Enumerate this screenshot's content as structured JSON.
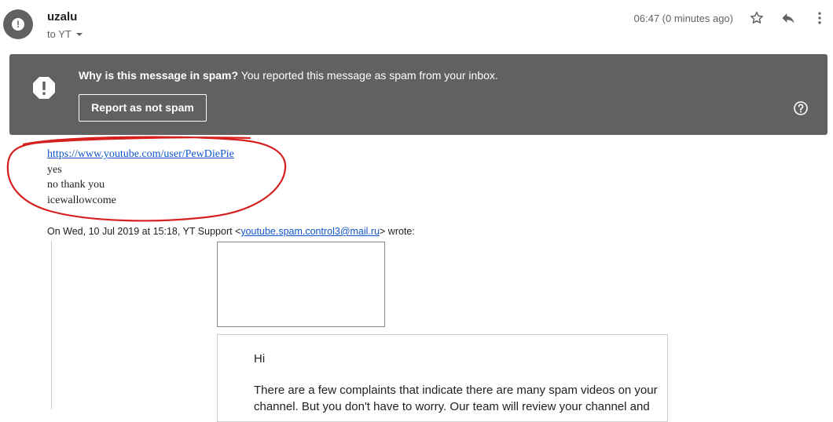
{
  "header": {
    "sender": "uzalu",
    "recipient": "to YT",
    "timestamp": "06:47 (0 minutes ago)",
    "icons": {
      "avatar": "warning-icon",
      "star": "star-icon",
      "reply": "reply-icon",
      "more": "more-vert-icon"
    }
  },
  "banner": {
    "title": "Why is this message in spam?",
    "description": " You reported this message as spam from your inbox.",
    "button_label": "Report as not spam",
    "icons": {
      "warning": "warning-icon",
      "help": "help-icon"
    },
    "bg_color": "#616161"
  },
  "message": {
    "link": "https://www.youtube.com/user/PewDiePie",
    "lines": [
      "yes",
      "no thank you",
      "icewallowcome"
    ],
    "annotation_color": "#d62020"
  },
  "quote": {
    "intro_prefix": "On Wed, 10 Jul 2019 at 15:18, YT Support <",
    "email": "youtube.spam.control3@mail.ru",
    "intro_suffix": "> wrote:",
    "greeting": "Hi",
    "paragraph": "There are a few complaints that indicate there are many spam videos on your channel. But you don't have to worry. Our team will review your channel and"
  }
}
